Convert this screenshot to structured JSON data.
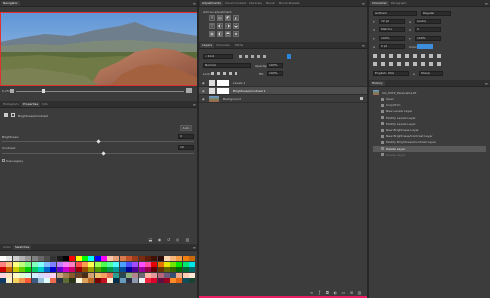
{
  "navigator": {
    "tab": "Navigator",
    "zoom": "6.25%"
  },
  "properties": {
    "tabs": [
      "Histogram",
      "Properties",
      "Info"
    ],
    "active_tab": "Properties",
    "title": "Brightness/Contrast",
    "auto_label": "Auto",
    "brightness_label": "Brightness:",
    "brightness_value": "0",
    "contrast_label": "Contrast:",
    "contrast_value": "10",
    "legacy_label": "Use Legacy",
    "brightness_level": 0.5,
    "contrast_level": 0.53
  },
  "swatches_panel": {
    "tabs": [
      "Color",
      "Swatches"
    ],
    "active_tab": "Swatches"
  },
  "adjustments": {
    "tabs": [
      "Adjustments",
      "Cloud Content",
      "Libraries",
      "Brush",
      "Brush Presets"
    ],
    "active_tab": "Adjustments",
    "subtitle": "Add an adjustment"
  },
  "layers": {
    "tabs": [
      "Layers",
      "Channels",
      "Paths"
    ],
    "active_tab": "Layers",
    "kind_label": "Kind",
    "blend_mode": "Normal",
    "opacity_label": "Opacity:",
    "opacity_value": "100%",
    "lock_label": "Lock:",
    "fill_label": "Fill:",
    "fill_value": "100%",
    "rows": [
      {
        "name": "Levels 1"
      },
      {
        "name": "Brightness/Contrast 1"
      },
      {
        "name": "Background"
      }
    ]
  },
  "character": {
    "tabs": [
      "Character",
      "Paragraph"
    ],
    "active_tab": "Character",
    "font_family": "Gotham",
    "font_style": "Regular",
    "size": "72 pt",
    "leading": "(Auto)",
    "kerning": "Metrics",
    "tracking": "0",
    "vscale": "100%",
    "hscale": "100%",
    "baseline": "0 pt",
    "color_label": "Color:",
    "color_hex": "#3d8fdd",
    "language": "English: USA",
    "antialias": "Sharp"
  },
  "history": {
    "tab": "History",
    "document": "CO_0372_Panorama.tif",
    "items": [
      "Open",
      "Crop/Trim",
      "New Levels Layer",
      "Modify Levels Layer",
      "Modify Levels Layer",
      "New Brightness Layer",
      "New Brightness/Contrast Layer",
      "Modify Brightness/Contrast Layer",
      "Delete Layer",
      "Delete Layer"
    ],
    "active_index": 8,
    "dim_index": 9
  },
  "colors": {
    "accent": "#3d8fdd",
    "panel_bg": "#3c3c3c",
    "dark_bg": "#2b2b2b"
  }
}
